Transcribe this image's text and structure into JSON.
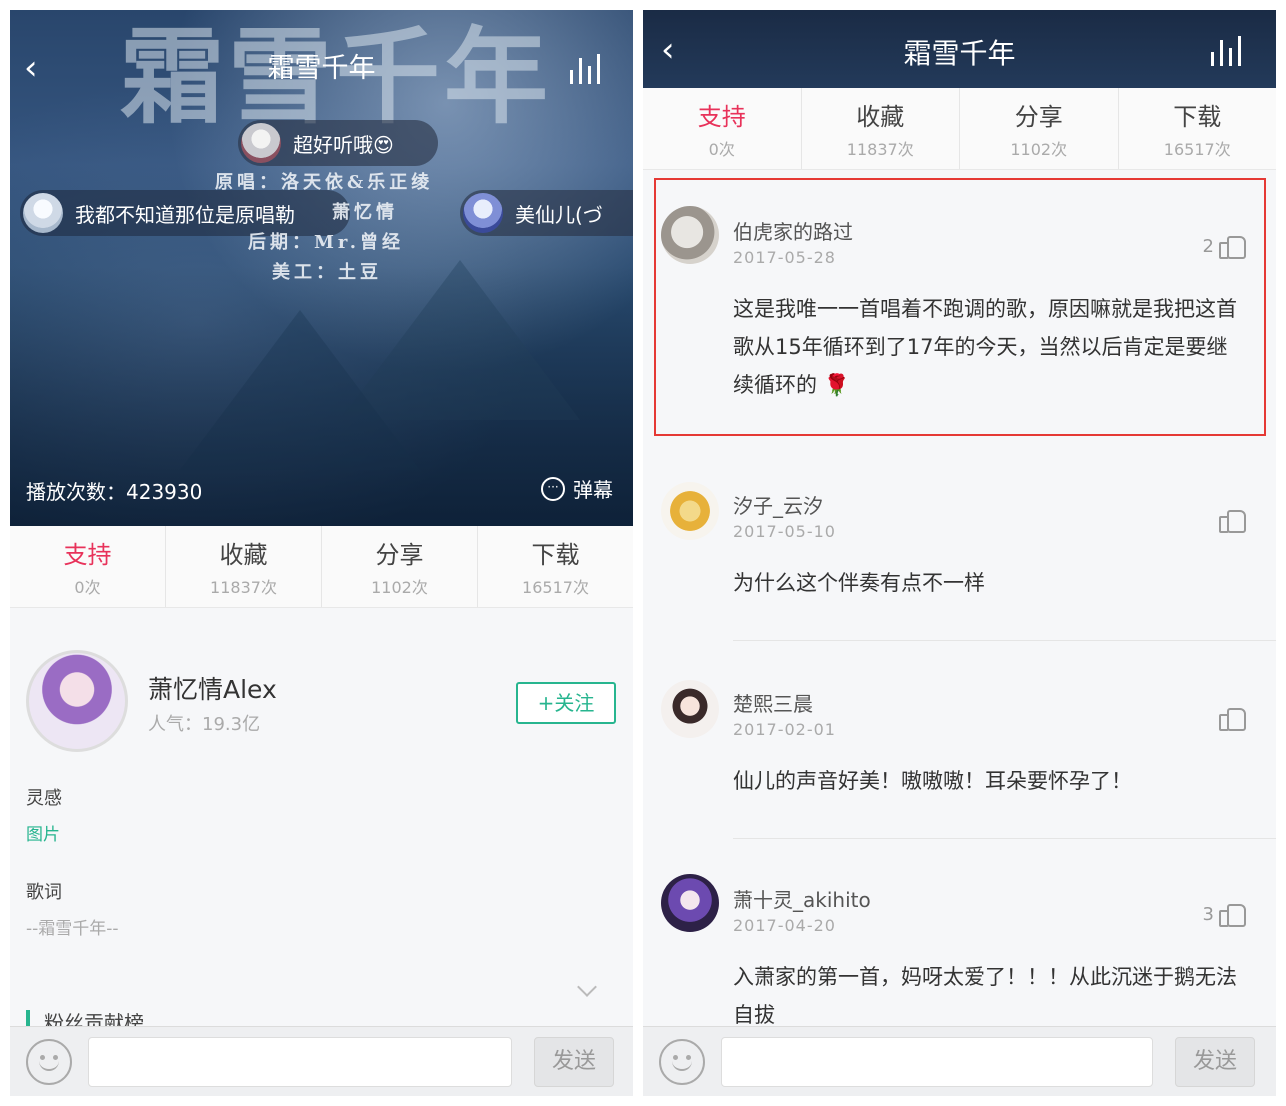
{
  "song_title": "霜雪千年",
  "left": {
    "poster_calligraphy": "霜雪千年",
    "danmu": [
      {
        "text": "超好听哦😍"
      },
      {
        "text": "我都不知道那位是原唱勒"
      },
      {
        "text": "美仙儿(づ"
      }
    ],
    "credits": [
      "原唱：洛天依&乐正绫",
      "萧忆情",
      "后期：Mr.曾经",
      "美工：土豆"
    ],
    "play_count": "播放次数：423930",
    "danmaku_label": "弹幕",
    "author": {
      "name": "萧忆情Alex",
      "popularity": "人气：19.3亿",
      "follow_label": "+关注"
    },
    "inspiration_label": "灵感",
    "inspiration_link": "图片",
    "lyrics_label": "歌词",
    "lyrics_text": "--霜雪千年--",
    "fans_title": "粉丝贡献榜"
  },
  "stats": [
    {
      "label": "支持",
      "count": "0次"
    },
    {
      "label": "收藏",
      "count": "11837次"
    },
    {
      "label": "分享",
      "count": "1102次"
    },
    {
      "label": "下载",
      "count": "16517次"
    }
  ],
  "comments": [
    {
      "user": "伯虎家的路过",
      "date": "2017-05-28",
      "likes": "2",
      "text": "这是我唯一一首唱着不跑调的歌，原因嘛就是我把这首歌从15年循环到了17年的今天，当然以后肯定是要继续循环的",
      "emoji": "🌹"
    },
    {
      "user": "汐子_云汐",
      "date": "2017-05-10",
      "likes": "",
      "text": "为什么这个伴奏有点不一样"
    },
    {
      "user": "楚熙三晨",
      "date": "2017-02-01",
      "likes": "",
      "text": "仙儿的声音好美！嗷嗷嗷！耳朵要怀孕了！"
    },
    {
      "user": "萧十灵_akihito",
      "date": "2017-04-20",
      "likes": "3",
      "text": "入萧家的第一首，妈呀太爱了！！！从此沉迷于鹅无法自拔"
    }
  ],
  "input": {
    "placeholder": "",
    "send_label": "发送"
  },
  "colors": {
    "accent_red": "#e8325a",
    "accent_green": "#27b58f",
    "highlight_box": "#e53935"
  }
}
